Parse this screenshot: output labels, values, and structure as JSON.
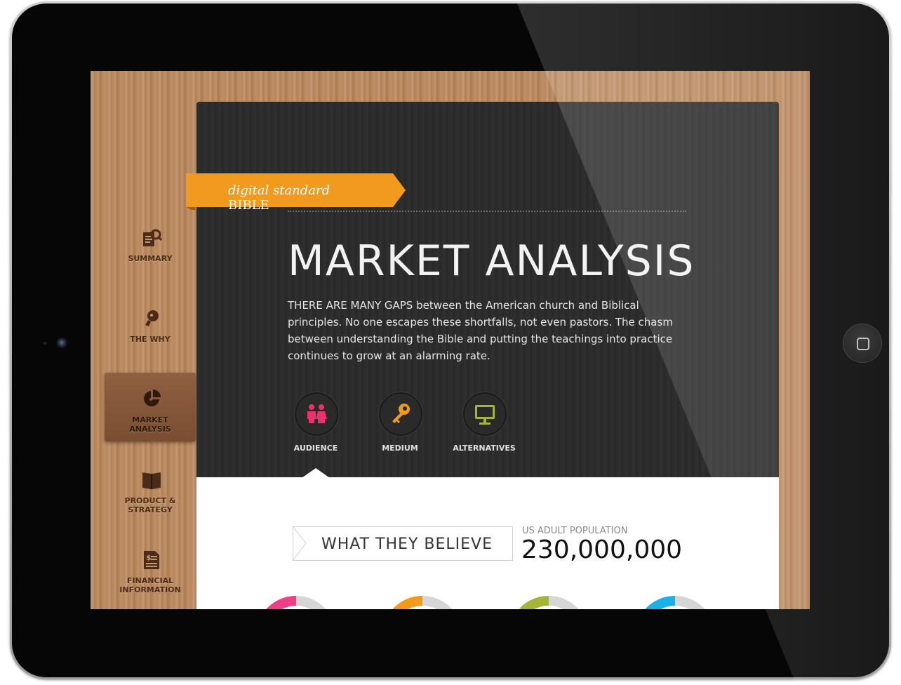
{
  "sidebar": {
    "items": [
      {
        "label": "SUMMARY",
        "icon": "summary-search-icon",
        "active": false
      },
      {
        "label": "THE WHY",
        "icon": "lightbulb-icon",
        "active": false
      },
      {
        "label": "MARKET\nANALYSIS",
        "icon": "pie-chart-icon",
        "active": true
      },
      {
        "label": "PRODUCT &\nSTRATEGY",
        "icon": "book-icon",
        "active": false
      },
      {
        "label": "FINANCIAL\nINFORMATION",
        "icon": "financial-document-icon",
        "active": false
      }
    ]
  },
  "ribbon": {
    "italic": "digital standard",
    "bold": "BIBLE",
    "color": "#f29a1d"
  },
  "main": {
    "title": "MARKET ANALYSIS",
    "intro": "THERE ARE MANY GAPS between the American church and Biblical principles. No one escapes these shortfalls, not even pastors. The chasm between understanding the Bible and putting the teachings into practice continues to grow at an alarming rate.",
    "tabs": [
      {
        "label": "AUDIENCE",
        "icon": "people-icon",
        "color": "#e8336d",
        "active": true
      },
      {
        "label": "MEDIUM",
        "icon": "key-icon",
        "color": "#f29a1d",
        "active": false
      },
      {
        "label": "ALTERNATIVES",
        "icon": "monitor-icon",
        "color": "#a4b53a",
        "active": false
      }
    ]
  },
  "section": {
    "heading": "WHAT THEY BELIEVE",
    "pop_label": "US ADULT POPULATION",
    "pop_value": "230,000,000"
  },
  "donut_colors": [
    "#ee3f86",
    "#f29a1d",
    "#a4b53a",
    "#19b1e8"
  ],
  "colors": {
    "dark_panel": "#2c2c2c",
    "wood": "#bd8e64",
    "accent": "#f29a1d"
  }
}
